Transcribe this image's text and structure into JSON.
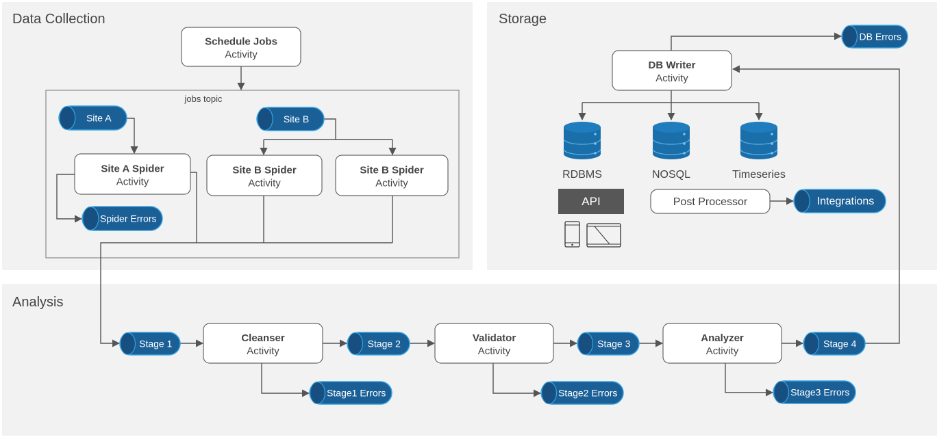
{
  "panels": {
    "data_collection": "Data Collection",
    "storage": "Storage",
    "analysis": "Analysis"
  },
  "jobs_topic_label": "jobs topic",
  "activities": {
    "schedule": {
      "title": "Schedule Jobs",
      "sub": "Activity"
    },
    "site_a_spider": {
      "title": "Site A Spider",
      "sub": "Activity"
    },
    "site_b_spider_1": {
      "title": "Site B Spider",
      "sub": "Activity"
    },
    "site_b_spider_2": {
      "title": "Site B Spider",
      "sub": "Activity"
    },
    "db_writer": {
      "title": "DB Writer",
      "sub": "Activity"
    },
    "cleanser": {
      "title": "Cleanser",
      "sub": "Activity"
    },
    "validator": {
      "title": "Validator",
      "sub": "Activity"
    },
    "analyzer": {
      "title": "Analyzer",
      "sub": "Activity"
    }
  },
  "topics": {
    "site_a": "Site A",
    "site_b": "Site B",
    "spider_errors": "Spider Errors",
    "db_errors": "DB Errors",
    "integrations": "Integrations",
    "stage1": "Stage 1",
    "stage2": "Stage 2",
    "stage3": "Stage 3",
    "stage4": "Stage 4",
    "stage1_errors": "Stage1 Errors",
    "stage2_errors": "Stage2 Errors",
    "stage3_errors": "Stage3 Errors"
  },
  "databases": {
    "rdbms": "RDBMS",
    "nosql": "NOSQL",
    "timeseries": "Timeseries"
  },
  "api_label": "API",
  "post_processor": "Post Processor",
  "icons": [
    "database-icon",
    "phone-icon",
    "tablet-icon"
  ],
  "colors": {
    "panel": "#f2f2f2",
    "topic_fill": "#1b5f97",
    "topic_edge": "#35a3e0",
    "db": "#1a6fab",
    "api": "#575757",
    "line": "#555555"
  }
}
